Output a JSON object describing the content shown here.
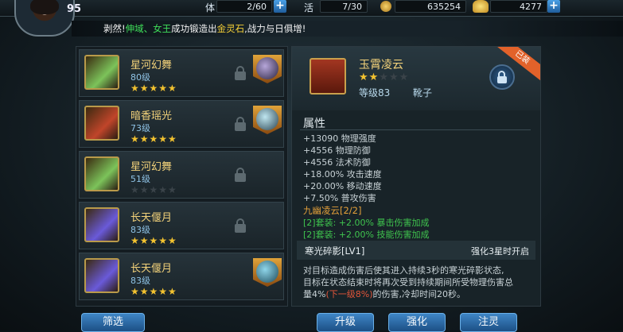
{
  "player": {
    "level": "95"
  },
  "resources": {
    "stamina_label": "体",
    "stamina": "2/60",
    "vigor_label": "活",
    "vigor": "7/30",
    "coins": "635254",
    "ingots": "4277"
  },
  "notice": {
    "prefix": "剥然!",
    "name1": "伸域",
    "sep": "、",
    "name2": "女王",
    "mid": "成功锻造出",
    "item": "金灵石",
    "suffix": ",战力与日俱增!"
  },
  "equipment_list": [
    {
      "name": "星河幻舞",
      "level": "80级",
      "stars": 5,
      "locked": true,
      "has_gem": true
    },
    {
      "name": "暗香瑶光",
      "level": "73级",
      "stars": 5,
      "locked": true,
      "has_gem": true
    },
    {
      "name": "星河幻舞",
      "level": "51级",
      "stars": 0,
      "locked": true,
      "has_gem": false
    },
    {
      "name": "长天偃月",
      "level": "83级",
      "stars": 5,
      "locked": true,
      "has_gem": false
    },
    {
      "name": "长天偃月",
      "level": "83级",
      "stars": 5,
      "locked": false,
      "has_gem": true
    }
  ],
  "detail": {
    "name": "玉霄凌云",
    "stars": 2,
    "max_stars": 5,
    "level": "等级83",
    "type": "靴子",
    "ribbon": "已装"
  },
  "attributes": {
    "title": "属性",
    "lines": [
      "+13090 物理强度",
      "+4556 物理防御",
      "+4556 法术防御",
      "+18.00% 攻击速度",
      "+20.00% 移动速度",
      "+7.50% 普攻伤害"
    ]
  },
  "set": {
    "title": "九幽凌云[2/2]",
    "bonus1": "[2]套装: +2.00% 暴击伤害加成",
    "bonus2": "[2]套装: +2.00% 技能伤害加成"
  },
  "skill": {
    "name": "寒光碎影[LV1]",
    "requirement": "强化3星时开启",
    "desc1": "对目标造成伤害后使其进入持续3秒的寒光碎影状态,",
    "desc2": "目标在状态结束时将再次受到持续期间所受物理伤害总",
    "desc3_a": "量4%",
    "desc3_red": "(下一级8%)",
    "desc3_b": "的伤害,冷却时间20秒。"
  },
  "buttons": {
    "filter": "筛选",
    "upgrade": "升级",
    "enhance": "强化",
    "infuse": "注灵"
  },
  "colors": {
    "accent": "#3f86c6",
    "gold": "#f3d27a",
    "green": "#3fe05a",
    "orange": "#e4a03a"
  }
}
